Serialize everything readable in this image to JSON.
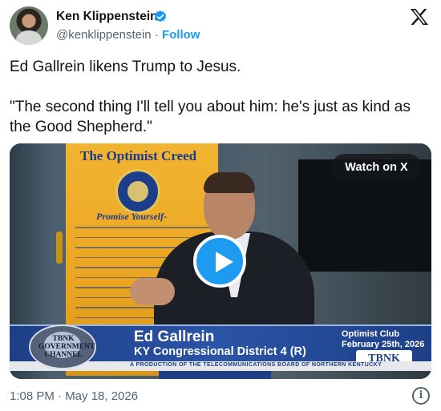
{
  "author": {
    "name": "Ken Klippenstein",
    "handle": "@kenklippenstein",
    "separator": "·",
    "follow_label": "Follow",
    "verified": true
  },
  "tweet": {
    "line1": "Ed Gallrein likens Trump to Jesus.",
    "line2": "\"The second thing I'll tell you about him: he's just as kind as the Good Shepherd.\""
  },
  "video": {
    "watch_label": "Watch on X",
    "banner_title": "The Optimist Creed",
    "banner_subtitle": "Promise Yourself-",
    "lower_third": {
      "name": "Ed Gallrein",
      "title": "KY Congressional District 4 (R)",
      "event_line1": "Optimist Club",
      "event_line2": "February 25th, 2026",
      "production_note": "A PRODUCTION OF THE TELECOMMUNICATIONS BOARD OF NORTHERN KENTUCKY",
      "channel_logo": "TBNK",
      "badge_text": "TBNK GOVERNMENT CHANNEL"
    }
  },
  "timestamp": "1:08 PM · May 18, 2026",
  "colors": {
    "accent": "#1d9bf0",
    "text": "#0f1419",
    "muted": "#536471",
    "lower_third_blue": "#1e3f86",
    "banner_gold": "#f2b531"
  },
  "icons": {
    "verified": "verified-badge-icon",
    "x_logo": "x-logo-icon",
    "play": "play-icon",
    "info": "info-icon"
  }
}
